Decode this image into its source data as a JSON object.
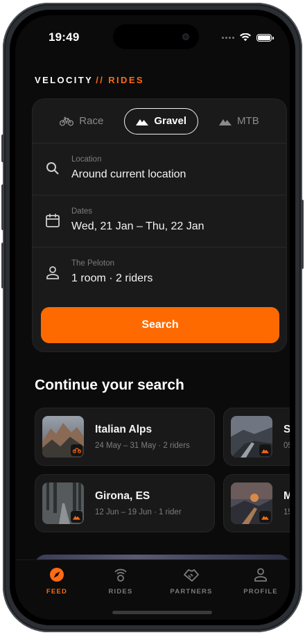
{
  "status": {
    "time": "19:49"
  },
  "brand": {
    "name": "VELOCITY",
    "sep_accent": "// RIDES"
  },
  "ride_types": [
    {
      "label": "Race",
      "icon": "bicycle-icon",
      "active": false
    },
    {
      "label": "Gravel",
      "icon": "mountain-icon",
      "active": true
    },
    {
      "label": "MTB",
      "icon": "mountain-icon",
      "active": false
    }
  ],
  "fields": {
    "location": {
      "label": "Location",
      "value": "Around current location"
    },
    "dates": {
      "label": "Dates",
      "value": "Wed, 21 Jan – Thu, 22 Jan"
    },
    "peloton": {
      "label": "The Peloton",
      "value": "1 room · 2 riders"
    }
  },
  "search_button": "Search",
  "section_title": "Continue your search",
  "recent": [
    [
      {
        "title": "Italian Alps",
        "sub": "24 May – 31 May · 2 riders",
        "badge": "bicycle-icon"
      },
      {
        "title": "S",
        "sub": "05",
        "badge": "mountain-icon"
      }
    ],
    [
      {
        "title": "Girona, ES",
        "sub": "12 Jun – 19 Jun · 1 rider",
        "badge": "mountain-icon"
      },
      {
        "title": "M",
        "sub": "15",
        "badge": "mountain-icon"
      }
    ]
  ],
  "tabs": [
    {
      "label": "FEED",
      "icon": "compass-icon",
      "active": true
    },
    {
      "label": "RIDES",
      "icon": "rides-icon",
      "active": false
    },
    {
      "label": "PARTNERS",
      "icon": "handshake-icon",
      "active": false
    },
    {
      "label": "PROFILE",
      "icon": "person-icon",
      "active": false
    }
  ],
  "colors": {
    "accent": "#ff6a00",
    "background": "#0b0b0b",
    "card": "#1a1a1a"
  }
}
